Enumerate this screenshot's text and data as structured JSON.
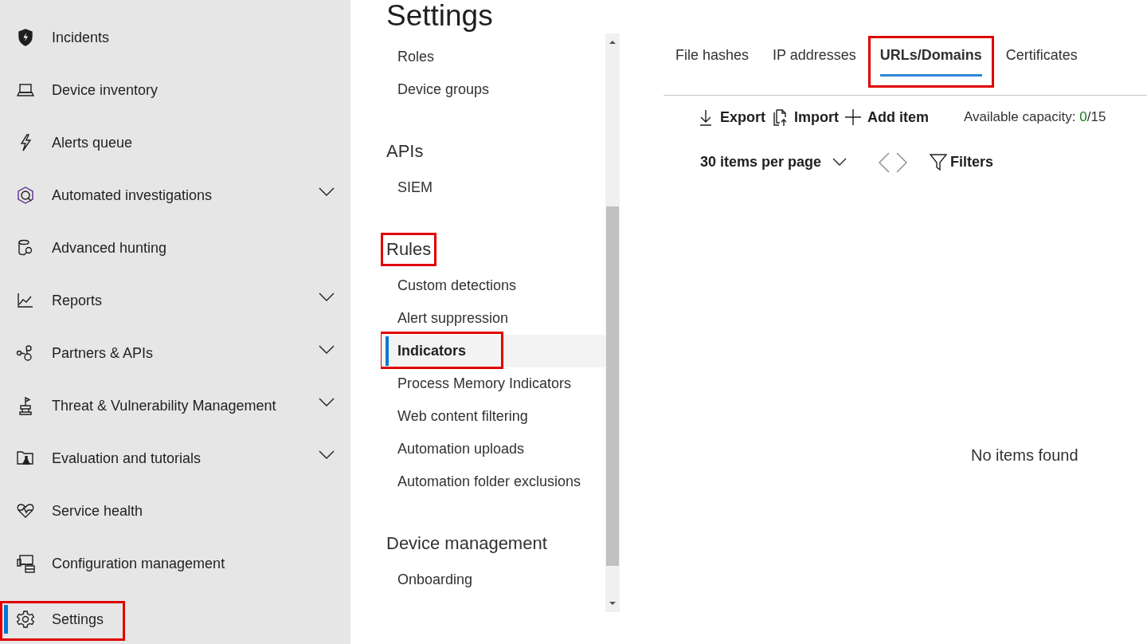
{
  "sidebar": {
    "items": [
      {
        "label": "Incidents",
        "selected": false,
        "highlighted": false
      },
      {
        "label": "Device inventory",
        "selected": false,
        "highlighted": false
      },
      {
        "label": "Alerts queue",
        "selected": false,
        "highlighted": false
      },
      {
        "label": "Automated investigations",
        "selected": false,
        "highlighted": false,
        "expanded": false
      },
      {
        "label": "Advanced hunting",
        "selected": false,
        "highlighted": false
      },
      {
        "label": "Reports",
        "selected": false,
        "highlighted": false,
        "expanded": false
      },
      {
        "label": "Partners & APIs",
        "selected": false,
        "highlighted": false,
        "expanded": false
      },
      {
        "label": "Threat & Vulnerability Management",
        "selected": false,
        "highlighted": false,
        "expanded": false
      },
      {
        "label": "Evaluation and tutorials",
        "selected": false,
        "highlighted": false,
        "expanded": false
      },
      {
        "label": "Service health",
        "selected": false,
        "highlighted": false
      },
      {
        "label": "Configuration management",
        "selected": false,
        "highlighted": false
      },
      {
        "label": "Settings",
        "selected": true,
        "highlighted": true
      }
    ]
  },
  "page_title": "Settings",
  "settings_nav": {
    "sections": [
      {
        "items": [
          {
            "label": "Roles",
            "selected": false,
            "highlighted": false
          },
          {
            "label": "Device groups",
            "selected": false,
            "highlighted": false
          }
        ]
      },
      {
        "heading": "APIs",
        "highlighted": false,
        "items": [
          {
            "label": "SIEM",
            "selected": false,
            "highlighted": false
          }
        ]
      },
      {
        "heading": "Rules",
        "highlighted": true,
        "items": [
          {
            "label": "Custom detections",
            "selected": false,
            "highlighted": false
          },
          {
            "label": "Alert suppression",
            "selected": false,
            "highlighted": false
          },
          {
            "label": "Indicators",
            "selected": true,
            "highlighted": true
          },
          {
            "label": "Process Memory Indicators",
            "selected": false,
            "highlighted": false
          },
          {
            "label": "Web content filtering",
            "selected": false,
            "highlighted": false
          },
          {
            "label": "Automation uploads",
            "selected": false,
            "highlighted": false
          },
          {
            "label": "Automation folder exclusions",
            "selected": false,
            "highlighted": false
          }
        ]
      },
      {
        "heading": "Device management",
        "highlighted": false,
        "items": [
          {
            "label": "Onboarding",
            "selected": false,
            "highlighted": false
          }
        ]
      }
    ]
  },
  "tabs": [
    {
      "label": "File hashes",
      "selected": false,
      "highlighted": false
    },
    {
      "label": "IP addresses",
      "selected": false,
      "highlighted": false
    },
    {
      "label": "URLs/Domains",
      "selected": true,
      "highlighted": true
    },
    {
      "label": "Certificates",
      "selected": false,
      "highlighted": false
    }
  ],
  "toolbar": {
    "actions": [
      {
        "label": "Export"
      },
      {
        "label": "Import"
      },
      {
        "label": "Add item"
      }
    ],
    "capacity_label": "Available capacity:",
    "capacity_used": "0",
    "capacity_total": "/15"
  },
  "paging": {
    "page_size": "30 items per page",
    "filters": "Filters"
  },
  "empty_message": "No items found"
}
